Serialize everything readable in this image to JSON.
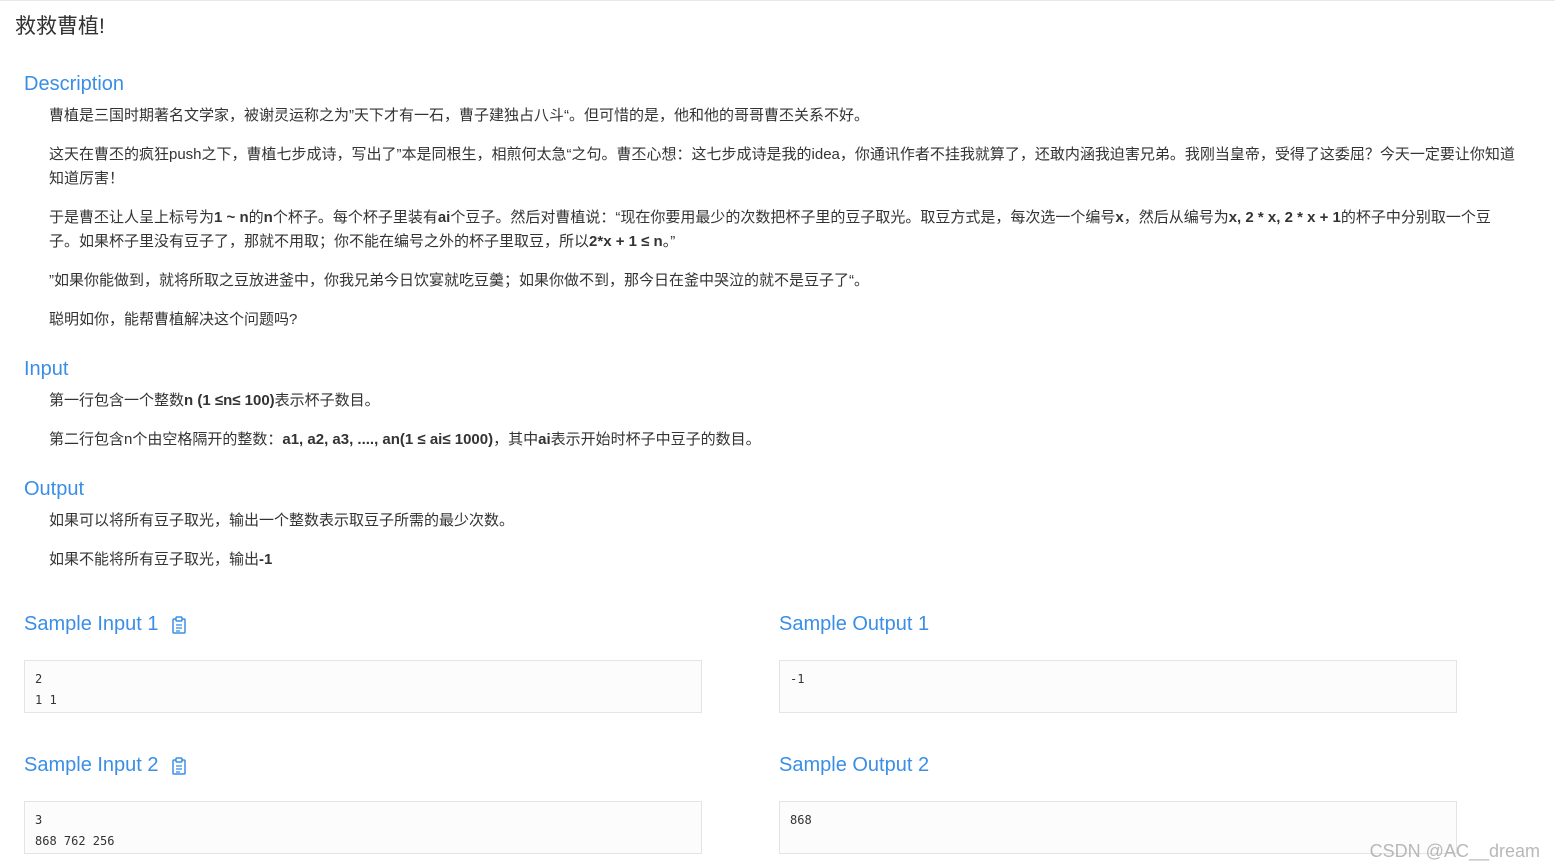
{
  "problem": {
    "title": "救救曹植!"
  },
  "description": {
    "heading": "Description",
    "p1": "曹植是三国时期著名文学家，被谢灵运称之为”天下才有一石，曹子建独占八斗“。但可惜的是，他和他的哥哥曹丕关系不好。",
    "p2": "这天在曹丕的疯狂push之下，曹植七步成诗，写出了”本是同根生，相煎何太急“之句。曹丕心想：这七步成诗是我的idea，你通讯作者不挂我就算了，还敢内涵我迫害兄弟。我刚当皇帝，受得了这委屈？今天一定要让你知道知道厉害！",
    "p3_a": "于是曹丕让人呈上标号为",
    "p3_b1": "1 ~ n",
    "p3_c": "的",
    "p3_b2": "n",
    "p3_d": "个杯子。每个杯子里装有",
    "p3_b3": "ai",
    "p3_e": "个豆子。然后对曹植说：“现在你要用最少的次数把杯子里的豆子取光。取豆方式是，每次选一个编号",
    "p3_b4": "x",
    "p3_f": "，然后从编号为",
    "p3_b5": "x, 2 * x, 2 * x + 1",
    "p3_g": "的杯子中分别取一个豆子。如果杯子里没有豆子了，那就不用取；你不能在编号之外的杯子里取豆，所以",
    "p3_b6": "2*x + 1  ≤ n",
    "p3_h": "。”",
    "p4": "”如果你能做到，就将所取之豆放进釜中，你我兄弟今日饮宴就吃豆羹；如果你做不到，那今日在釜中哭泣的就不是豆子了“。",
    "p5": "聪明如你，能帮曹植解决这个问题吗?"
  },
  "input": {
    "heading": "Input",
    "p1_a": "第一行包含一个整数",
    "p1_b": "n (1 ≤n≤ 100)",
    "p1_c": "表示杯子数目。",
    "p2_a": "第二行包含n个由空格隔开的整数：",
    "p2_b": "a1, a2, a3, ...., an(1 ≤ ai≤ 1000)",
    "p2_c": "，其中",
    "p2_d": "ai",
    "p2_e": "表示开始时杯子中豆子的数目。"
  },
  "output": {
    "heading": "Output",
    "p1": "如果可以将所有豆子取光，输出一个整数表示取豆子所需的最少次数。",
    "p2_a": "如果不能将所有豆子取光，输出",
    "p2_b": "-1"
  },
  "samples": {
    "input1_title": "Sample Input 1",
    "input1": "2\n1 1",
    "output1_title": "Sample Output 1",
    "output1": "-1",
    "input2_title": "Sample Input 2",
    "input2": "3\n868 762 256",
    "output2_title": "Sample Output 2",
    "output2": "868"
  },
  "watermark": "CSDN @AC__dream",
  "colors": {
    "heading": "#3a8ee6",
    "text": "#333333"
  }
}
